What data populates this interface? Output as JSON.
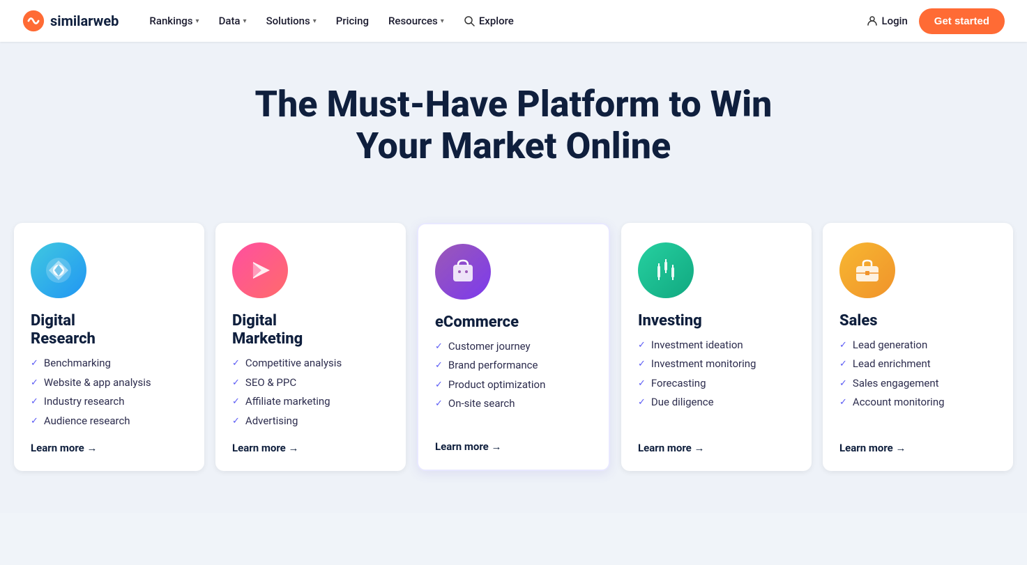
{
  "nav": {
    "logo_text": "similarweb",
    "items": [
      {
        "label": "Rankings",
        "has_chevron": true
      },
      {
        "label": "Data",
        "has_chevron": true
      },
      {
        "label": "Solutions",
        "has_chevron": true
      },
      {
        "label": "Pricing",
        "has_chevron": false
      },
      {
        "label": "Resources",
        "has_chevron": true
      }
    ],
    "explore_label": "Explore",
    "login_label": "Login",
    "cta_label": "Get started"
  },
  "hero": {
    "title": "The Must-Have Platform to Win Your Market Online"
  },
  "cards": [
    {
      "id": "digital-research",
      "icon_style": "blue",
      "title": "Digital\nResearch",
      "items": [
        "Benchmarking",
        "Website & app analysis",
        "Industry research",
        "Audience research"
      ],
      "learn_more": "Learn more →",
      "highlighted": false
    },
    {
      "id": "digital-marketing",
      "icon_style": "pink",
      "title": "Digital\nMarketing",
      "items": [
        "Competitive analysis",
        "SEO & PPC",
        "Affiliate marketing",
        "Advertising"
      ],
      "learn_more": "Learn more →",
      "highlighted": false
    },
    {
      "id": "ecommerce",
      "icon_style": "purple",
      "title": "eCommerce",
      "items": [
        "Customer journey",
        "Brand performance",
        "Product optimization",
        "On-site search"
      ],
      "learn_more": "Learn more →",
      "highlighted": true
    },
    {
      "id": "investing",
      "icon_style": "green",
      "title": "Investing",
      "items": [
        "Investment ideation",
        "Investment monitoring",
        "Forecasting",
        "Due diligence"
      ],
      "learn_more": "Learn more →",
      "highlighted": false
    },
    {
      "id": "sales",
      "icon_style": "orange",
      "title": "Sales",
      "items": [
        "Lead generation",
        "Lead enrichment",
        "Sales engagement",
        "Account monitoring"
      ],
      "learn_more": "Learn more →",
      "highlighted": false
    }
  ]
}
